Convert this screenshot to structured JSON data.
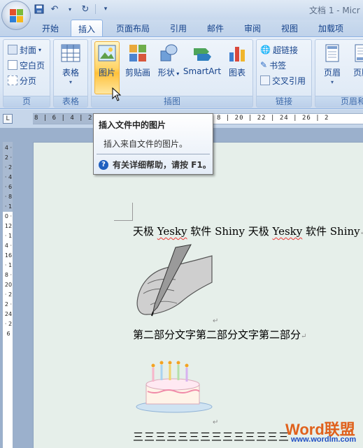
{
  "window": {
    "title": "文档 1 - Micr"
  },
  "tabs": [
    "开始",
    "插入",
    "页面布局",
    "引用",
    "邮件",
    "审阅",
    "视图",
    "加载项"
  ],
  "active_tab": "插入",
  "ribbon": {
    "page_group": {
      "label": "页",
      "items": [
        "封面",
        "空白页",
        "分页"
      ]
    },
    "table_group": {
      "label": "表格",
      "button": "表格"
    },
    "illustrations_group": {
      "label": "插图",
      "buttons": [
        "图片",
        "剪贴画",
        "形状",
        "SmartArt",
        "图表"
      ]
    },
    "links_group": {
      "label": "链接",
      "items": [
        "超链接",
        "书签",
        "交叉引用"
      ]
    },
    "header_group": {
      "label": "页眉和",
      "buttons": [
        "页眉",
        "页脚"
      ]
    }
  },
  "ruler": {
    "h_left": "8 | 6 | 4 | 2 | ",
    "h_right": "8 | 20 | 22 | 24 | 26 | 2",
    "v_marks": "4 · 2 · · 2 · 4 · 6 · 8 · 10 · 12 · 14 · 16 · 18 · 20 · 22 · 24 · 26"
  },
  "tooltip": {
    "title": "插入文件中的图片",
    "description": "插入来自文件的图片。",
    "help": "有关详细帮助，请按 F1。"
  },
  "document": {
    "line1_parts": [
      "天极 ",
      "Yesky",
      " 软件 Shiny 天极 ",
      "Yesky",
      " 软件 Shiny"
    ],
    "line2": "第二部分文字第二部分文字第二部分",
    "line3": "三三三三三三三三三三三三三三",
    "para_mark": "↵"
  },
  "watermark": {
    "brand": "Word联盟",
    "url": "www.wordlm.com"
  },
  "colors": {
    "ribbon_text": "#15428b",
    "highlight": "#ffd56a",
    "page_bg": "#e6efea"
  }
}
